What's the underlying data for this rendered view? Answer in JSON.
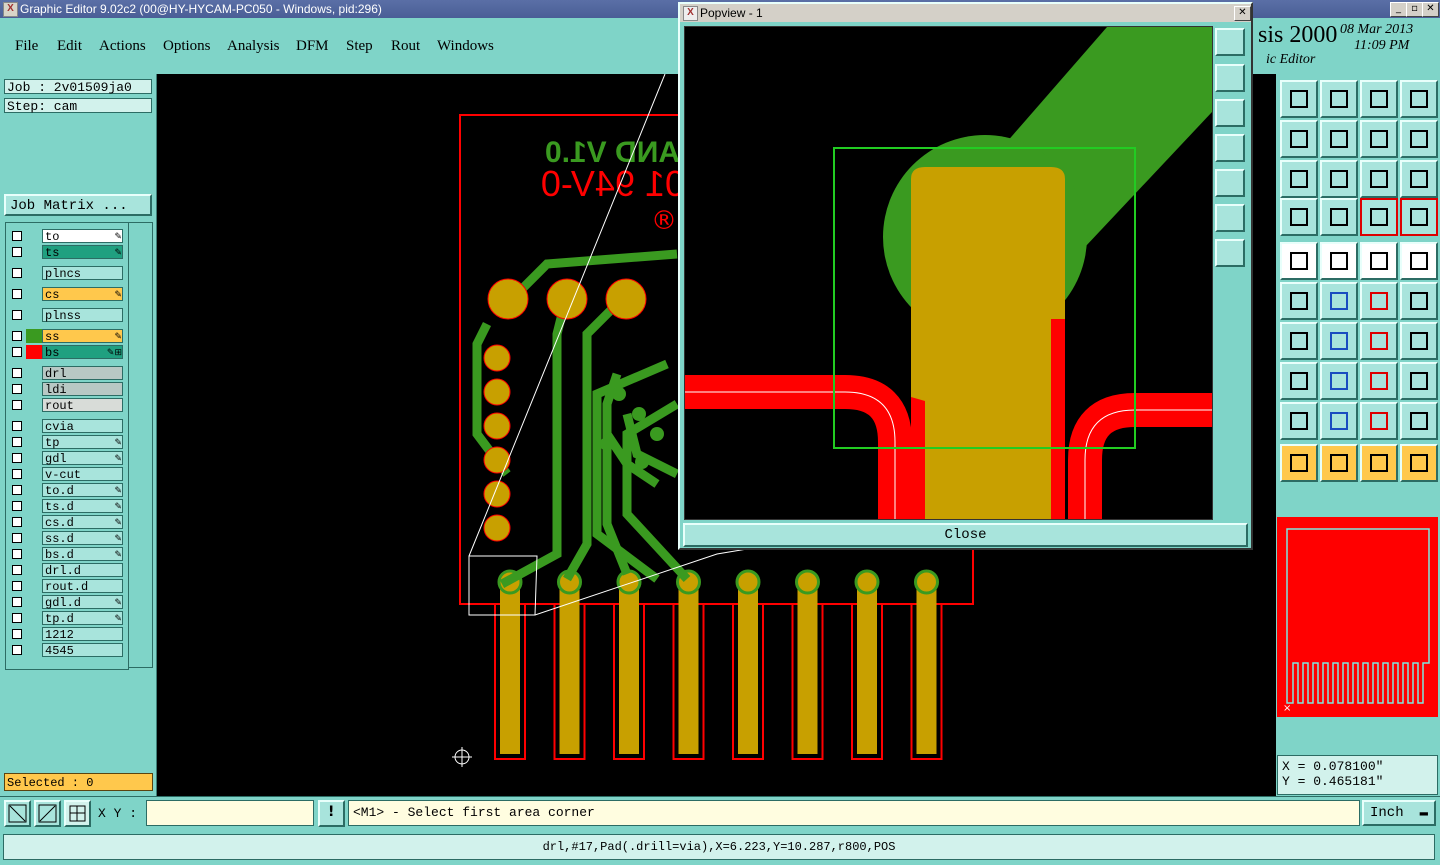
{
  "window": {
    "title": "Graphic Editor 9.02c2 (00@HY-HYCAM-PC050 - Windows, pid:296)"
  },
  "menu": [
    "File",
    "Edit",
    "Actions",
    "Options",
    "Analysis",
    "DFM",
    "Step",
    "Rout",
    "Windows"
  ],
  "branding": {
    "product": "sis 2000",
    "subtitle": "ic Editor",
    "date": "08 Mar 2013",
    "time": "11:09 PM"
  },
  "job": {
    "job_label": "Job : 2v01509ja0",
    "step_label": "Step: cam",
    "matrix_button": "Job Matrix ..."
  },
  "layers": [
    {
      "name": "to",
      "color": "#ffffff",
      "mark": "✎",
      "swatch": ""
    },
    {
      "name": "ts",
      "color": "#20a080",
      "mark": "✎",
      "swatch": ""
    },
    {
      "name": "plncs",
      "color": "#a8e4dc",
      "mark": "",
      "swatch": ""
    },
    {
      "name": "cs",
      "color": "#ffc84c",
      "mark": "✎",
      "swatch": ""
    },
    {
      "name": "plnss",
      "color": "#a8e4dc",
      "mark": "",
      "swatch": ""
    },
    {
      "name": "ss",
      "color": "#ffc84c",
      "mark": "✎",
      "swatch": "#3a9a20"
    },
    {
      "name": "bs",
      "color": "#20a080",
      "mark": "✎⊞",
      "swatch": "#ff0000"
    },
    {
      "name": "drl",
      "color": "#b8c8c4",
      "mark": "",
      "swatch": ""
    },
    {
      "name": "ldi",
      "color": "#b8c8c4",
      "mark": "",
      "swatch": ""
    },
    {
      "name": "rout",
      "color": "#d8dcd8",
      "mark": "",
      "swatch": ""
    },
    {
      "name": "cvia",
      "color": "#a8e4dc",
      "mark": "",
      "swatch": ""
    },
    {
      "name": "tp",
      "color": "#a8e4dc",
      "mark": "✎",
      "swatch": ""
    },
    {
      "name": "gdl",
      "color": "#a8e4dc",
      "mark": "✎",
      "swatch": ""
    },
    {
      "name": "v-cut",
      "color": "#a8e4dc",
      "mark": "",
      "swatch": ""
    },
    {
      "name": "to.d",
      "color": "#a8e4dc",
      "mark": "✎",
      "swatch": ""
    },
    {
      "name": "ts.d",
      "color": "#a8e4dc",
      "mark": "✎",
      "swatch": ""
    },
    {
      "name": "cs.d",
      "color": "#a8e4dc",
      "mark": "✎",
      "swatch": ""
    },
    {
      "name": "ss.d",
      "color": "#a8e4dc",
      "mark": "✎",
      "swatch": ""
    },
    {
      "name": "bs.d",
      "color": "#a8e4dc",
      "mark": "✎",
      "swatch": ""
    },
    {
      "name": "drl.d",
      "color": "#a8e4dc",
      "mark": "",
      "swatch": ""
    },
    {
      "name": "rout.d",
      "color": "#a8e4dc",
      "mark": "",
      "swatch": ""
    },
    {
      "name": "gdl.d",
      "color": "#a8e4dc",
      "mark": "✎",
      "swatch": ""
    },
    {
      "name": "tp.d",
      "color": "#a8e4dc",
      "mark": "✎",
      "swatch": ""
    },
    {
      "name": "1212",
      "color": "#a8e4dc",
      "mark": "",
      "swatch": ""
    },
    {
      "name": "4545",
      "color": "#a8e4dc",
      "mark": "",
      "swatch": ""
    }
  ],
  "selected": "Selected : 0",
  "pcb_text": {
    "line1": "AND V1.0",
    "line2": "01 94V-0",
    "mark": "®"
  },
  "popview": {
    "title": "Popview - 1",
    "close_button": "Close"
  },
  "coords": {
    "x": "X = 0.078100\"",
    "y": "Y = 0.465181\""
  },
  "bottom": {
    "xy_label": "X Y :",
    "xy_value": "",
    "prompt": "<M1> - Select first area corner",
    "units": "Inch",
    "status": "drl,#17,Pad(.drill=via),X=6.223,Y=10.287,r800,POS"
  },
  "colors": {
    "panel": "#7fd4c8",
    "copper": "#c8a000",
    "trace": "#3a9a20",
    "mask": "#ff0000",
    "highlight": "#ffc84c"
  }
}
